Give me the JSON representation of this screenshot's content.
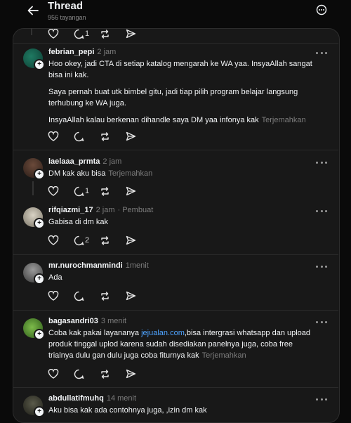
{
  "header": {
    "title": "Thread",
    "views": "956 tayangan"
  },
  "translate_label": "Terjemahkan",
  "top_actions": {
    "reply_count": "1"
  },
  "posts": [
    {
      "username": "febrian_pepi",
      "time": "2 jam",
      "paragraphs": [
        "Hoo okey, jadi CTA di setiap katalog mengarah ke WA yaa. InsyaAllah sangat bisa ini kak.",
        "Saya pernah buat utk bimbel gitu, jadi tiap pilih program belajar langsung terhubung ke WA juga.",
        "InsyaAllah kalau berkenan dihandle saya DM yaa infonya kak"
      ],
      "reply_count": ""
    },
    {
      "username": "laelaaa_prmta",
      "time": "2 jam",
      "text": "DM kak aku bisa",
      "reply_count": "1"
    },
    {
      "username": "rifqiazmi_17",
      "time": "2 jam",
      "tag": "· Pembuat",
      "text": "Gabisa di dm kak",
      "reply_count": "2"
    },
    {
      "username": "mr.nurochmanmindi",
      "time": "1menit",
      "text": "Ada",
      "reply_count": ""
    },
    {
      "username": "bagasandri03",
      "time": "3 menit",
      "text_before_link": "Coba kak pakai layananya ",
      "link": "jejualan.com",
      "text_after_link": ",bisa intergrasi whatsapp dan upload produk tinggal uplod karena sudah disediakan panelnya juga, coba free trialnya dulu gan dulu juga coba fiturnya kak",
      "reply_count": ""
    },
    {
      "username": "abdullatifmuhq",
      "time": "14 menit",
      "text": "Aku bisa kak ada contohnya juga, ,izin dm kak"
    }
  ],
  "colors": {
    "background": "#0a0a0a",
    "card": "#181818",
    "link": "#4ea3ff",
    "muted": "#7d7d7d"
  },
  "icons": [
    "back-arrow-icon",
    "more-circle-icon",
    "heart-icon",
    "reply-icon",
    "repost-icon",
    "share-icon",
    "more-dots-icon",
    "follow-plus-icon"
  ]
}
